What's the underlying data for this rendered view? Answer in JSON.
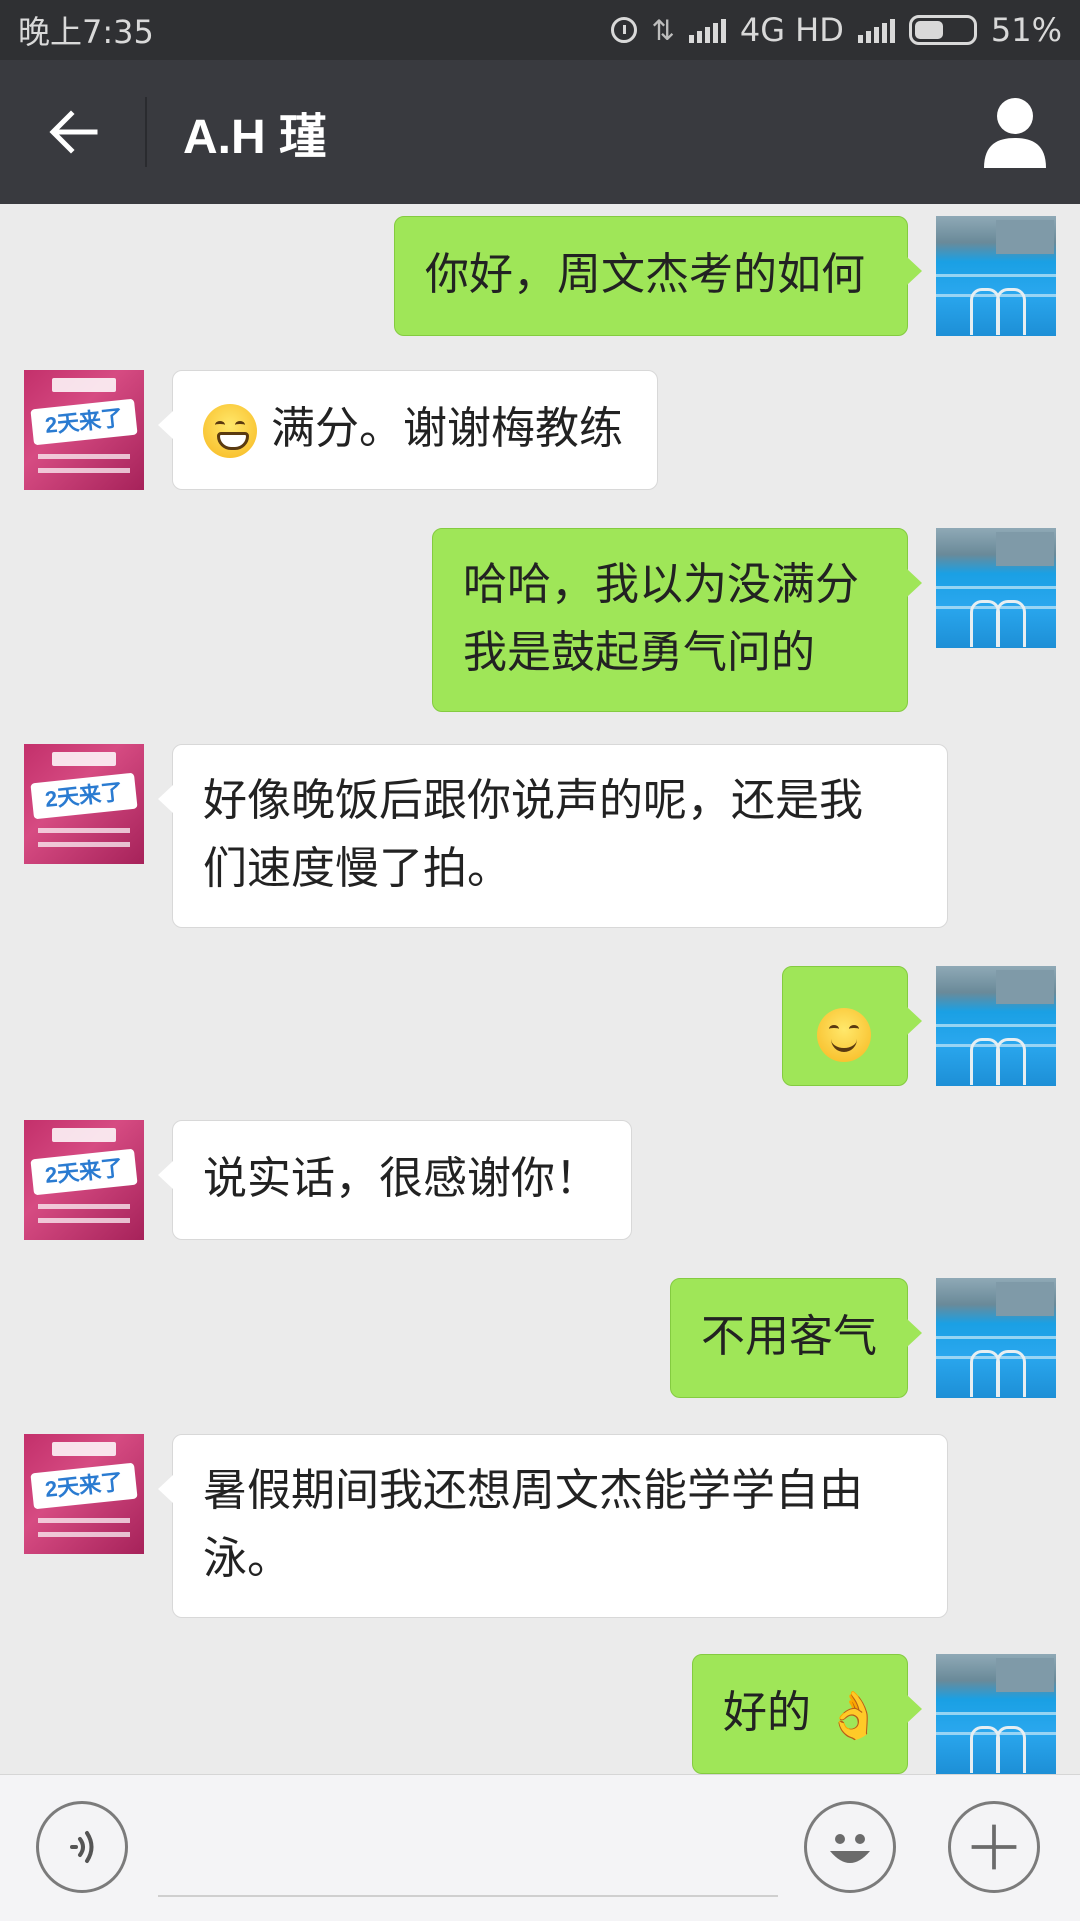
{
  "status_bar": {
    "time": "晚上7:35",
    "network": "4G HD",
    "battery": "51%"
  },
  "header": {
    "title": "A.H 瑾",
    "back_icon": "arrow-left-icon",
    "profile_icon": "person-icon"
  },
  "messages": [
    {
      "side": "out",
      "text": "你好，周文杰考的如何"
    },
    {
      "side": "in",
      "emoji": "grinning-face",
      "text": "满分。谢谢梅教练"
    },
    {
      "side": "out",
      "lines": [
        "哈哈，我以为没满分",
        "我是鼓起勇气问的"
      ]
    },
    {
      "side": "in",
      "lines": [
        "好像晚饭后跟你说声的呢，还是我",
        "们速度慢了拍。"
      ]
    },
    {
      "side": "out",
      "emoji": "smiling-face"
    },
    {
      "side": "in",
      "text": "说实话，很感谢你！"
    },
    {
      "side": "out",
      "text": "不用客气"
    },
    {
      "side": "in",
      "lines": [
        "暑假期间我还想周文杰能学学自由",
        "泳。"
      ]
    },
    {
      "side": "out",
      "text": "好的",
      "emoji": "ok-hand"
    }
  ],
  "contact_avatar_text": "2天来了",
  "input_bar": {
    "voice_icon": "voice-icon",
    "emoji_icon": "emoji-icon",
    "plus_icon": "plus-icon"
  }
}
